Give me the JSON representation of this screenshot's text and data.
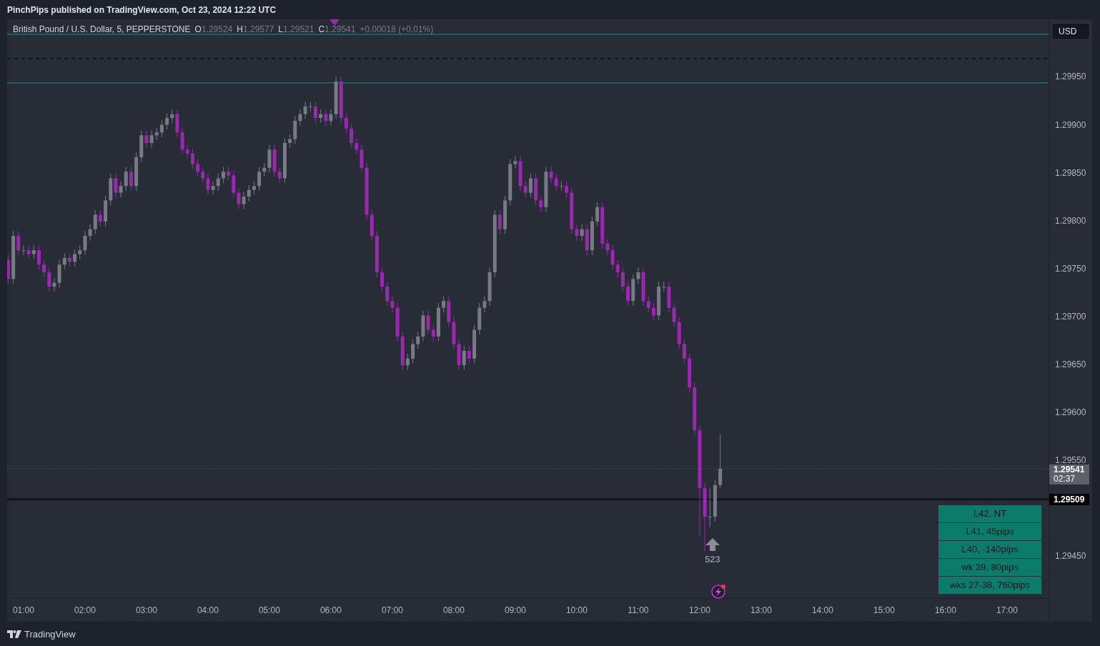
{
  "published": "PinchPips published on TradingView.com, Oct 23, 2024 12:22 UTC",
  "legend": {
    "symbol": "British Pound / U.S. Dollar, 5, PEPPERSTONE",
    "ohlc": [
      {
        "label": "O",
        "value": "1.29524"
      },
      {
        "label": "H",
        "value": "1.29577"
      },
      {
        "label": "L",
        "value": "1.29521"
      },
      {
        "label": "C",
        "value": "1.29541"
      }
    ],
    "change": "+0.00018 (+0.01%)"
  },
  "currency_button": "USD",
  "chart": {
    "chart_data": {
      "type": "candlestick",
      "xlim": [
        44,
        1060.5
      ],
      "ylim": [
        1.29406,
        1.3001
      ],
      "xticks": [
        {
          "value": 60,
          "label": "01:00"
        },
        {
          "value": 120,
          "label": "02:00"
        },
        {
          "value": 180,
          "label": "03:00"
        },
        {
          "value": 240,
          "label": "04:00"
        },
        {
          "value": 300,
          "label": "05:00"
        },
        {
          "value": 360,
          "label": "06:00"
        },
        {
          "value": 420,
          "label": "07:00"
        },
        {
          "value": 480,
          "label": "08:00"
        },
        {
          "value": 540,
          "label": "09:00"
        },
        {
          "value": 600,
          "label": "10:00"
        },
        {
          "value": 660,
          "label": "11:00"
        },
        {
          "value": 720,
          "label": "12:00"
        },
        {
          "value": 780,
          "label": "13:00"
        },
        {
          "value": 840,
          "label": "14:00"
        },
        {
          "value": 900,
          "label": "15:00"
        },
        {
          "value": 960,
          "label": "16:00"
        },
        {
          "value": 1020,
          "label": "17:00"
        }
      ],
      "yticks": [
        {
          "value": 1.2995,
          "label": "1.29950"
        },
        {
          "value": 1.299,
          "label": "1.29900"
        },
        {
          "value": 1.2985,
          "label": "1.29850"
        },
        {
          "value": 1.298,
          "label": "1.29800"
        },
        {
          "value": 1.2975,
          "label": "1.29750"
        },
        {
          "value": 1.297,
          "label": "1.29700"
        },
        {
          "value": 1.2965,
          "label": "1.29650"
        },
        {
          "value": 1.296,
          "label": "1.29600"
        },
        {
          "value": 1.2955,
          "label": "1.29550"
        },
        {
          "value": 1.2945,
          "label": "1.29450"
        }
      ],
      "x": [
        45,
        50,
        55,
        60,
        65,
        70,
        75,
        80,
        85,
        90,
        95,
        100,
        105,
        110,
        115,
        120,
        125,
        130,
        135,
        140,
        145,
        150,
        155,
        160,
        165,
        170,
        175,
        180,
        185,
        190,
        195,
        200,
        205,
        210,
        215,
        220,
        225,
        230,
        235,
        240,
        245,
        250,
        255,
        260,
        265,
        270,
        275,
        280,
        285,
        290,
        295,
        300,
        305,
        310,
        315,
        320,
        325,
        330,
        335,
        340,
        345,
        350,
        355,
        360,
        365,
        370,
        375,
        380,
        385,
        390,
        395,
        400,
        405,
        410,
        415,
        420,
        425,
        430,
        435,
        440,
        445,
        450,
        455,
        460,
        465,
        470,
        475,
        480,
        485,
        490,
        495,
        500,
        505,
        510,
        515,
        520,
        525,
        530,
        535,
        540,
        545,
        550,
        555,
        560,
        565,
        570,
        575,
        580,
        585,
        590,
        595,
        600,
        605,
        610,
        615,
        620,
        625,
        630,
        635,
        640,
        645,
        650,
        655,
        660,
        665,
        670,
        675,
        680,
        685,
        690,
        695,
        700,
        705,
        710,
        715,
        720,
        725,
        730,
        735,
        740
      ],
      "ohlc": [
        [
          1.29759,
          1.29764,
          1.29734,
          1.29739
        ],
        [
          1.29739,
          1.29789,
          1.29734,
          1.29784
        ],
        [
          1.29784,
          1.29789,
          1.29764,
          1.29769
        ],
        [
          1.29769,
          1.29774,
          1.29764,
          1.29769
        ],
        [
          1.29769,
          1.29774,
          1.2976,
          1.29765
        ],
        [
          1.29765,
          1.29774,
          1.2976,
          1.29769
        ],
        [
          1.29769,
          1.29774,
          1.29749,
          1.29754
        ],
        [
          1.29754,
          1.29759,
          1.29741,
          1.29746
        ],
        [
          1.29746,
          1.29751,
          1.29726,
          1.29731
        ],
        [
          1.29731,
          1.2974,
          1.29726,
          1.29735
        ],
        [
          1.29735,
          1.29759,
          1.2973,
          1.29754
        ],
        [
          1.29754,
          1.29766,
          1.29749,
          1.29761
        ],
        [
          1.29761,
          1.29766,
          1.29752,
          1.29757
        ],
        [
          1.29757,
          1.2977,
          1.29752,
          1.29765
        ],
        [
          1.29765,
          1.29774,
          1.2976,
          1.29769
        ],
        [
          1.29769,
          1.29789,
          1.29764,
          1.29784
        ],
        [
          1.29784,
          1.29796,
          1.29779,
          1.29791
        ],
        [
          1.29791,
          1.29811,
          1.29786,
          1.29806
        ],
        [
          1.29806,
          1.29811,
          1.29794,
          1.29799
        ],
        [
          1.29799,
          1.29826,
          1.29794,
          1.29821
        ],
        [
          1.29821,
          1.29849,
          1.29816,
          1.29844
        ],
        [
          1.29844,
          1.29849,
          1.29824,
          1.29829
        ],
        [
          1.29829,
          1.29841,
          1.29824,
          1.29836
        ],
        [
          1.29836,
          1.29856,
          1.29831,
          1.29851
        ],
        [
          1.29851,
          1.29856,
          1.29831,
          1.29836
        ],
        [
          1.29836,
          1.29871,
          1.29831,
          1.29866
        ],
        [
          1.29866,
          1.29894,
          1.29861,
          1.29889
        ],
        [
          1.29889,
          1.29894,
          1.29876,
          1.29881
        ],
        [
          1.29881,
          1.29894,
          1.29876,
          1.29889
        ],
        [
          1.29889,
          1.29897,
          1.29884,
          1.29892
        ],
        [
          1.29892,
          1.29905,
          1.29887,
          1.299
        ],
        [
          1.299,
          1.29912,
          1.29895,
          1.29907
        ],
        [
          1.29907,
          1.29916,
          1.29902,
          1.29911
        ],
        [
          1.29911,
          1.29916,
          1.29887,
          1.29892
        ],
        [
          1.29892,
          1.29897,
          1.29869,
          1.29874
        ],
        [
          1.29874,
          1.29879,
          1.29865,
          1.2987
        ],
        [
          1.2987,
          1.29875,
          1.29854,
          1.29859
        ],
        [
          1.29859,
          1.29864,
          1.29846,
          1.29851
        ],
        [
          1.29851,
          1.29856,
          1.29839,
          1.29844
        ],
        [
          1.29844,
          1.29849,
          1.29827,
          1.29832
        ],
        [
          1.29832,
          1.29841,
          1.29827,
          1.29836
        ],
        [
          1.29836,
          1.29849,
          1.29831,
          1.29844
        ],
        [
          1.29844,
          1.29856,
          1.29839,
          1.29851
        ],
        [
          1.29851,
          1.29856,
          1.29842,
          1.29847
        ],
        [
          1.29847,
          1.29852,
          1.29824,
          1.29829
        ],
        [
          1.29829,
          1.29834,
          1.29812,
          1.29817
        ],
        [
          1.29817,
          1.2983,
          1.29812,
          1.29825
        ],
        [
          1.29825,
          1.29837,
          1.2982,
          1.29832
        ],
        [
          1.29832,
          1.29841,
          1.29827,
          1.29836
        ],
        [
          1.29836,
          1.29856,
          1.29831,
          1.29851
        ],
        [
          1.29851,
          1.2986,
          1.29846,
          1.29855
        ],
        [
          1.29855,
          1.29879,
          1.2985,
          1.29874
        ],
        [
          1.29874,
          1.29879,
          1.29846,
          1.29851
        ],
        [
          1.29851,
          1.29856,
          1.29839,
          1.29844
        ],
        [
          1.29844,
          1.29886,
          1.29839,
          1.29881
        ],
        [
          1.29881,
          1.2989,
          1.29876,
          1.29885
        ],
        [
          1.29885,
          1.29909,
          1.2988,
          1.29904
        ],
        [
          1.29904,
          1.29916,
          1.29899,
          1.29911
        ],
        [
          1.29911,
          1.29924,
          1.29906,
          1.29919
        ],
        [
          1.29919,
          1.29924,
          1.29914,
          1.29919
        ],
        [
          1.29919,
          1.29924,
          1.29902,
          1.29907
        ],
        [
          1.29907,
          1.29916,
          1.29902,
          1.29911
        ],
        [
          1.29911,
          1.29916,
          1.29899,
          1.29904
        ],
        [
          1.29904,
          1.29916,
          1.29899,
          1.29911
        ],
        [
          1.29911,
          1.2995,
          1.29906,
          1.29945
        ],
        [
          1.29945,
          1.2995,
          1.29902,
          1.29907
        ],
        [
          1.29907,
          1.29912,
          1.29891,
          1.29896
        ],
        [
          1.29896,
          1.29901,
          1.29876,
          1.29881
        ],
        [
          1.29881,
          1.29886,
          1.29869,
          1.29874
        ],
        [
          1.29874,
          1.29879,
          1.2985,
          1.29855
        ],
        [
          1.29855,
          1.2986,
          1.29801,
          1.29806
        ],
        [
          1.29806,
          1.29811,
          1.29779,
          1.29784
        ],
        [
          1.29784,
          1.29789,
          1.29741,
          1.29746
        ],
        [
          1.29746,
          1.29751,
          1.29726,
          1.29731
        ],
        [
          1.29731,
          1.29736,
          1.29711,
          1.29716
        ],
        [
          1.29716,
          1.29721,
          1.29704,
          1.29709
        ],
        [
          1.29709,
          1.29714,
          1.29674,
          1.29679
        ],
        [
          1.29679,
          1.29684,
          1.29644,
          1.29649
        ],
        [
          1.29649,
          1.29661,
          1.29644,
          1.29656
        ],
        [
          1.29656,
          1.29676,
          1.29651,
          1.29671
        ],
        [
          1.29671,
          1.29684,
          1.29666,
          1.29679
        ],
        [
          1.29679,
          1.29706,
          1.29674,
          1.29701
        ],
        [
          1.29701,
          1.29706,
          1.29681,
          1.29686
        ],
        [
          1.29686,
          1.29691,
          1.29674,
          1.29679
        ],
        [
          1.29679,
          1.29714,
          1.29674,
          1.29709
        ],
        [
          1.29709,
          1.29721,
          1.29704,
          1.29716
        ],
        [
          1.29716,
          1.29721,
          1.29689,
          1.29694
        ],
        [
          1.29694,
          1.29699,
          1.29666,
          1.29671
        ],
        [
          1.29671,
          1.29676,
          1.29644,
          1.29649
        ],
        [
          1.29649,
          1.29669,
          1.29644,
          1.29664
        ],
        [
          1.29664,
          1.29669,
          1.29651,
          1.29656
        ],
        [
          1.29656,
          1.29691,
          1.29651,
          1.29686
        ],
        [
          1.29686,
          1.29714,
          1.29681,
          1.29709
        ],
        [
          1.29709,
          1.29721,
          1.29704,
          1.29716
        ],
        [
          1.29716,
          1.29751,
          1.29711,
          1.29746
        ],
        [
          1.29746,
          1.29811,
          1.29741,
          1.29806
        ],
        [
          1.29806,
          1.29811,
          1.29786,
          1.29791
        ],
        [
          1.29791,
          1.29826,
          1.29786,
          1.29821
        ],
        [
          1.29821,
          1.29864,
          1.29816,
          1.29859
        ],
        [
          1.29859,
          1.29867,
          1.29854,
          1.29862
        ],
        [
          1.29862,
          1.29867,
          1.29831,
          1.29836
        ],
        [
          1.29836,
          1.29841,
          1.29824,
          1.29829
        ],
        [
          1.29829,
          1.29849,
          1.29824,
          1.29844
        ],
        [
          1.29844,
          1.29849,
          1.29816,
          1.29821
        ],
        [
          1.29821,
          1.29826,
          1.29809,
          1.29814
        ],
        [
          1.29814,
          1.29856,
          1.29809,
          1.29851
        ],
        [
          1.29851,
          1.29856,
          1.29839,
          1.29844
        ],
        [
          1.29844,
          1.29849,
          1.29831,
          1.29836
        ],
        [
          1.29836,
          1.29841,
          1.29831,
          1.29836
        ],
        [
          1.29836,
          1.29841,
          1.29824,
          1.29829
        ],
        [
          1.29829,
          1.29834,
          1.29786,
          1.29791
        ],
        [
          1.29791,
          1.29796,
          1.29779,
          1.29784
        ],
        [
          1.29784,
          1.29796,
          1.29779,
          1.29791
        ],
        [
          1.29791,
          1.29796,
          1.29764,
          1.29769
        ],
        [
          1.29769,
          1.29804,
          1.29764,
          1.29799
        ],
        [
          1.29799,
          1.29819,
          1.29794,
          1.29814
        ],
        [
          1.29814,
          1.29819,
          1.29771,
          1.29776
        ],
        [
          1.29776,
          1.29781,
          1.29764,
          1.29769
        ],
        [
          1.29769,
          1.29774,
          1.29749,
          1.29754
        ],
        [
          1.29754,
          1.29759,
          1.29741,
          1.29746
        ],
        [
          1.29746,
          1.29751,
          1.29726,
          1.29731
        ],
        [
          1.29731,
          1.29736,
          1.29711,
          1.29716
        ],
        [
          1.29716,
          1.29744,
          1.29711,
          1.29739
        ],
        [
          1.29739,
          1.29751,
          1.29734,
          1.29746
        ],
        [
          1.29746,
          1.29751,
          1.29711,
          1.29716
        ],
        [
          1.29716,
          1.29721,
          1.29704,
          1.29709
        ],
        [
          1.29709,
          1.29714,
          1.29696,
          1.29701
        ],
        [
          1.29701,
          1.29736,
          1.29696,
          1.29731
        ],
        [
          1.29731,
          1.29736,
          1.29726,
          1.29731
        ],
        [
          1.29731,
          1.29736,
          1.29704,
          1.29709
        ],
        [
          1.29709,
          1.29714,
          1.29689,
          1.29694
        ],
        [
          1.29694,
          1.29699,
          1.29666,
          1.29671
        ],
        [
          1.29671,
          1.29676,
          1.29651,
          1.29656
        ],
        [
          1.29656,
          1.29661,
          1.29621,
          1.29626
        ],
        [
          1.29626,
          1.29631,
          1.29576,
          1.29581
        ],
        [
          1.29581,
          1.29586,
          1.29471,
          1.29521
        ],
        [
          1.29521,
          1.29526,
          1.29455,
          1.29491
        ],
        [
          1.29491,
          1.2952,
          1.2948,
          1.29491
        ],
        [
          1.29491,
          1.29529,
          1.29486,
          1.29524
        ],
        [
          1.29524,
          1.29577,
          1.29521,
          1.29541
        ]
      ]
    },
    "price_tags": [
      {
        "kind": "current",
        "price": "1.29541",
        "countdown": "02:37"
      },
      {
        "kind": "level",
        "price": "1.29509"
      }
    ],
    "signal_count": "523",
    "results_table": [
      "L42, NT",
      "L41, 45pips",
      "L40, -140pips",
      "wk 39, 80pips",
      "wks 27-38, 760pips"
    ]
  },
  "footer": {
    "brand": "TradingView"
  }
}
